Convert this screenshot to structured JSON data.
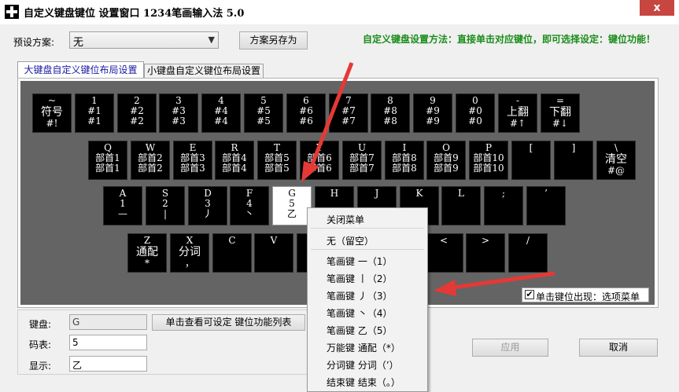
{
  "window": {
    "title": "自定义键盘键位 设置窗口 1234笔画输入法 5.0",
    "close_label": "x"
  },
  "scheme": {
    "label": "预设方案:",
    "value": "无",
    "save_as_label": "方案另存为"
  },
  "hint_text": "自定义键盘设置方法：直接单击对应键位，即可选择设定：键位功能！",
  "tabs": [
    {
      "label": "大键盘自定义键位布局设置"
    },
    {
      "label": "小键盘自定义键位布局设置"
    }
  ],
  "keyboard": {
    "row1": [
      {
        "l1": "~",
        "l2": "符号",
        "l3": "#!"
      },
      {
        "l1": "1",
        "l2": "#1",
        "l3": "#1"
      },
      {
        "l1": "2",
        "l2": "#2",
        "l3": "#2"
      },
      {
        "l1": "3",
        "l2": "#3",
        "l3": "#3"
      },
      {
        "l1": "4",
        "l2": "#4",
        "l3": "#4"
      },
      {
        "l1": "5",
        "l2": "#5",
        "l3": "#5"
      },
      {
        "l1": "6",
        "l2": "#6",
        "l3": "#6"
      },
      {
        "l1": "7",
        "l2": "#7",
        "l3": "#7"
      },
      {
        "l1": "8",
        "l2": "#8",
        "l3": "#8"
      },
      {
        "l1": "9",
        "l2": "#9",
        "l3": "#9"
      },
      {
        "l1": "0",
        "l2": "#0",
        "l3": "#0"
      },
      {
        "l1": "-",
        "l2": "上翻",
        "l3": "#↑"
      },
      {
        "l1": "=",
        "l2": "下翻",
        "l3": "#↓"
      }
    ],
    "row2": [
      {
        "l1": "Q",
        "l2": "部首1",
        "l3": "部首1"
      },
      {
        "l1": "W",
        "l2": "部首2",
        "l3": "部首2"
      },
      {
        "l1": "E",
        "l2": "部首3",
        "l3": "部首3"
      },
      {
        "l1": "R",
        "l2": "部首4",
        "l3": "部首4"
      },
      {
        "l1": "T",
        "l2": "部首5",
        "l3": "部首5"
      },
      {
        "l1": "Y",
        "l2": "部首6",
        "l3": "部首6"
      },
      {
        "l1": "U",
        "l2": "部首7",
        "l3": "部首7"
      },
      {
        "l1": "I",
        "l2": "部首8",
        "l3": "部首8"
      },
      {
        "l1": "O",
        "l2": "部首9",
        "l3": "部首9"
      },
      {
        "l1": "P",
        "l2": "部首10",
        "l3": "部首10"
      },
      {
        "l1": "[",
        "l2": "",
        "l3": ""
      },
      {
        "l1": "]",
        "l2": "",
        "l3": ""
      },
      {
        "l1": "\\",
        "l2": "清空",
        "l3": "#@"
      }
    ],
    "row3": [
      {
        "l1": "A",
        "l2": "1",
        "l3": "—"
      },
      {
        "l1": "S",
        "l2": "2",
        "l3": "|"
      },
      {
        "l1": "D",
        "l2": "3",
        "l3": "丿"
      },
      {
        "l1": "F",
        "l2": "4",
        "l3": "丶"
      },
      {
        "l1": "G",
        "l2": "5",
        "l3": "乙"
      },
      {
        "l1": "H",
        "l2": "",
        "l3": ""
      },
      {
        "l1": "J",
        "l2": "",
        "l3": ""
      },
      {
        "l1": "K",
        "l2": "",
        "l3": ""
      },
      {
        "l1": "L",
        "l2": "",
        "l3": ""
      },
      {
        "l1": ";",
        "l2": "",
        "l3": ""
      },
      {
        "l1": "’",
        "l2": "",
        "l3": ""
      }
    ],
    "row4": [
      {
        "l1": "Z",
        "l2": "通配",
        "l3": "*"
      },
      {
        "l1": "X",
        "l2": "分词",
        "l3": "，"
      },
      {
        "l1": "C",
        "l2": "",
        "l3": ""
      },
      {
        "l1": "V",
        "l2": "",
        "l3": ""
      },
      {
        "l1": "",
        "l2": "",
        "l3": ""
      },
      {
        "l1": "",
        "l2": "",
        "l3": ""
      },
      {
        "l1": "",
        "l2": "",
        "l3": ""
      },
      {
        "l1": "<",
        "l2": "",
        "l3": ""
      },
      {
        "l1": ">",
        "l2": "",
        "l3": ""
      },
      {
        "l1": "/",
        "l2": "",
        "l3": ""
      }
    ]
  },
  "context_menu": {
    "close": "关闭菜单",
    "none": "无（留空）",
    "items": [
      "笔画键 一（1）",
      "笔画键 丨（2）",
      "笔画键 丿（3）",
      "笔画键 丶（4）",
      "笔画键 乙（5）",
      "万能键 通配（*）",
      "分词键 分词（’）",
      "结束键 结束（。）"
    ]
  },
  "checkbox": {
    "label": "单击键位出现：选项菜单",
    "checked": true
  },
  "bottom": {
    "key_label": "键盘:",
    "key_value": "G",
    "list_button": "单击查看可设定 键位功能列表",
    "code_label": "码表:",
    "code_value": "5",
    "display_label": "显示:",
    "display_value": "乙"
  },
  "actions": {
    "apply": "应用",
    "cancel": "取消"
  },
  "colors": {
    "keyboard_bg": "#646464",
    "hint_green": "#1a8d1a",
    "arrow_red": "#e53935",
    "close_red": "#c7463f"
  }
}
